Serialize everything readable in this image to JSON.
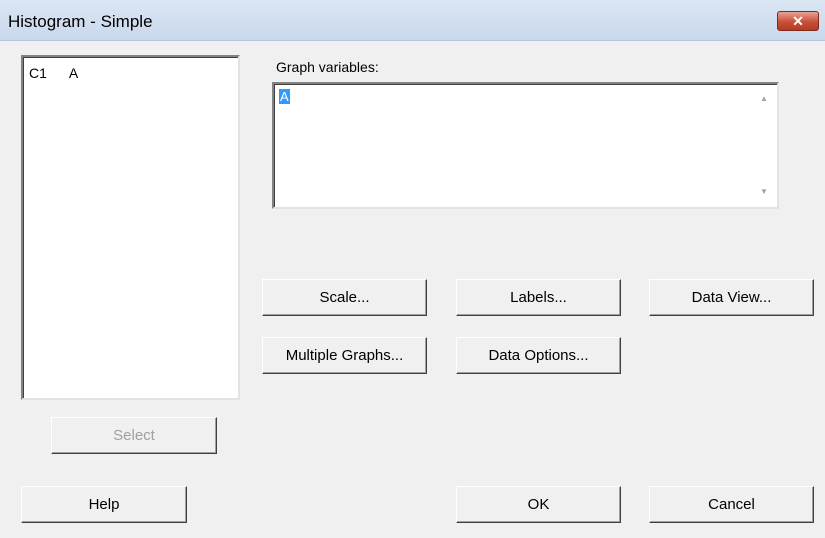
{
  "window": {
    "title": "Histogram - Simple",
    "close_symbol": "✕"
  },
  "variables_list": {
    "items": [
      {
        "column": "C1",
        "name": "A"
      }
    ]
  },
  "graph_variables": {
    "label": "Graph variables:",
    "value": "A"
  },
  "buttons": {
    "scale": "Scale...",
    "labels": "Labels...",
    "data_view": "Data View...",
    "multiple_graphs": "Multiple Graphs...",
    "data_options": "Data Options...",
    "select": "Select",
    "help": "Help",
    "ok": "OK",
    "cancel": "Cancel"
  }
}
